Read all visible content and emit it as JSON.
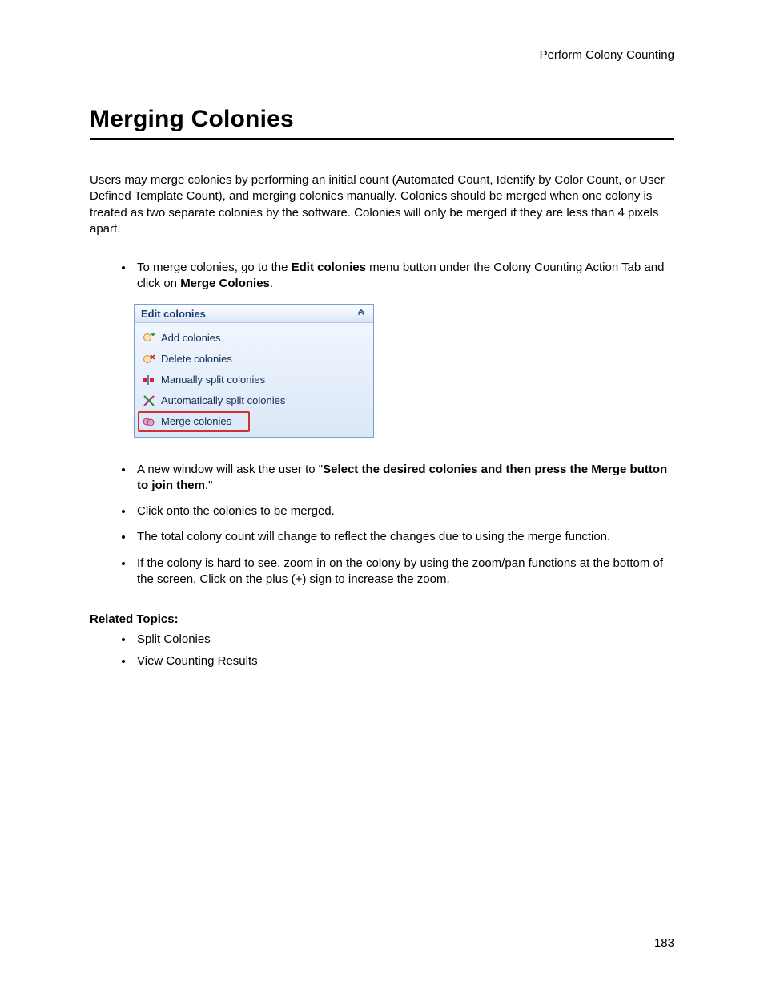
{
  "header": {
    "right": "Perform Colony Counting"
  },
  "title": "Merging Colonies",
  "intro": "Users may merge colonies by performing an initial count (Automated Count, Identify by Color Count, or User Defined Template Count), and merging colonies manually. Colonies should be merged when one colony is treated as two separate colonies by the software. Colonies will only be merged if they are less than 4 pixels apart.",
  "steps": {
    "s1_pre": "To merge colonies, go to the ",
    "s1_b1": "Edit colonies",
    "s1_mid": " menu button under the Colony Counting Action Tab and click on ",
    "s1_b2": "Merge Colonies",
    "s1_post": ".",
    "s2_pre": "A new window will ask the user to \"",
    "s2_b": "Select the desired colonies and then press the Merge button to join them",
    "s2_post": ".\"",
    "s3": "Click onto the colonies to be merged.",
    "s4": "The total colony count will change to reflect the changes due to using the merge function.",
    "s5": "If the colony is hard to see, zoom in on the colony by using the zoom/pan functions at the bottom of the screen.  Click on the plus (+) sign to increase the zoom."
  },
  "panel": {
    "title": "Edit colonies",
    "items": [
      "Add colonies",
      "Delete colonies",
      "Manually split colonies",
      "Automatically split colonies",
      "Merge colonies"
    ]
  },
  "related": {
    "title": "Related Topics:",
    "items": [
      "Split Colonies",
      "View Counting Results"
    ]
  },
  "page_number": "183"
}
